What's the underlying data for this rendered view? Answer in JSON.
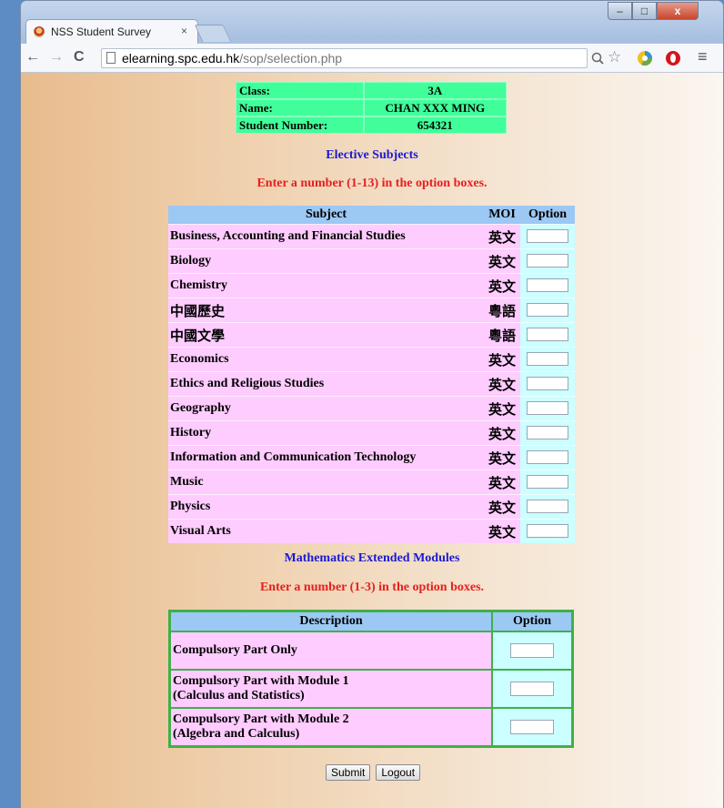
{
  "browser": {
    "tab_title": "NSS Student Survey",
    "tab_close": "×",
    "url_host": "elearning.spc.edu.hk",
    "url_path": "/sop/selection.php",
    "window_buttons": [
      "–",
      "□",
      "x"
    ],
    "nav": {
      "back": "←",
      "forward": "→",
      "reload": "C"
    },
    "toolbar_icons": [
      "zoom-icon",
      "star-icon",
      "extension-icon",
      "opera-icon",
      "menu-icon"
    ]
  },
  "student": {
    "class_label": "Class:",
    "class_value": "3A",
    "name_label": "Name:",
    "name_value": "CHAN XXX MING",
    "number_label": "Student Number:",
    "number_value": "654321"
  },
  "electives": {
    "heading": "Elective Subjects",
    "instruction": "Enter a number (1-13) in the option boxes.",
    "headers": [
      "Subject",
      "MOI",
      "Option"
    ],
    "rows": [
      {
        "subject": "Business, Accounting and Financial Studies",
        "moi": "英文"
      },
      {
        "subject": "Biology",
        "moi": "英文"
      },
      {
        "subject": "Chemistry",
        "moi": "英文"
      },
      {
        "subject": "中國歷史",
        "moi": "粵語"
      },
      {
        "subject": "中國文學",
        "moi": "粵語"
      },
      {
        "subject": "Economics",
        "moi": "英文"
      },
      {
        "subject": "Ethics and Religious Studies",
        "moi": "英文"
      },
      {
        "subject": "Geography",
        "moi": "英文"
      },
      {
        "subject": "History",
        "moi": "英文"
      },
      {
        "subject": "Information and Communication Technology",
        "moi": "英文"
      },
      {
        "subject": "Music",
        "moi": "英文"
      },
      {
        "subject": "Physics",
        "moi": "英文"
      },
      {
        "subject": "Visual Arts",
        "moi": "英文"
      }
    ]
  },
  "math": {
    "heading": "Mathematics Extended Modules",
    "instruction": "Enter a number (1-3) in the option boxes.",
    "headers": [
      "Description",
      "Option"
    ],
    "rows": [
      {
        "line1": "Compulsory Part Only",
        "line2": ""
      },
      {
        "line1": "Compulsory Part with Module 1",
        "line2": "(Calculus and Statistics)"
      },
      {
        "line1": "Compulsory Part with Module 2",
        "line2": "(Algebra and Calculus)"
      }
    ]
  },
  "actions": {
    "submit": "Submit",
    "logout": "Logout"
  }
}
